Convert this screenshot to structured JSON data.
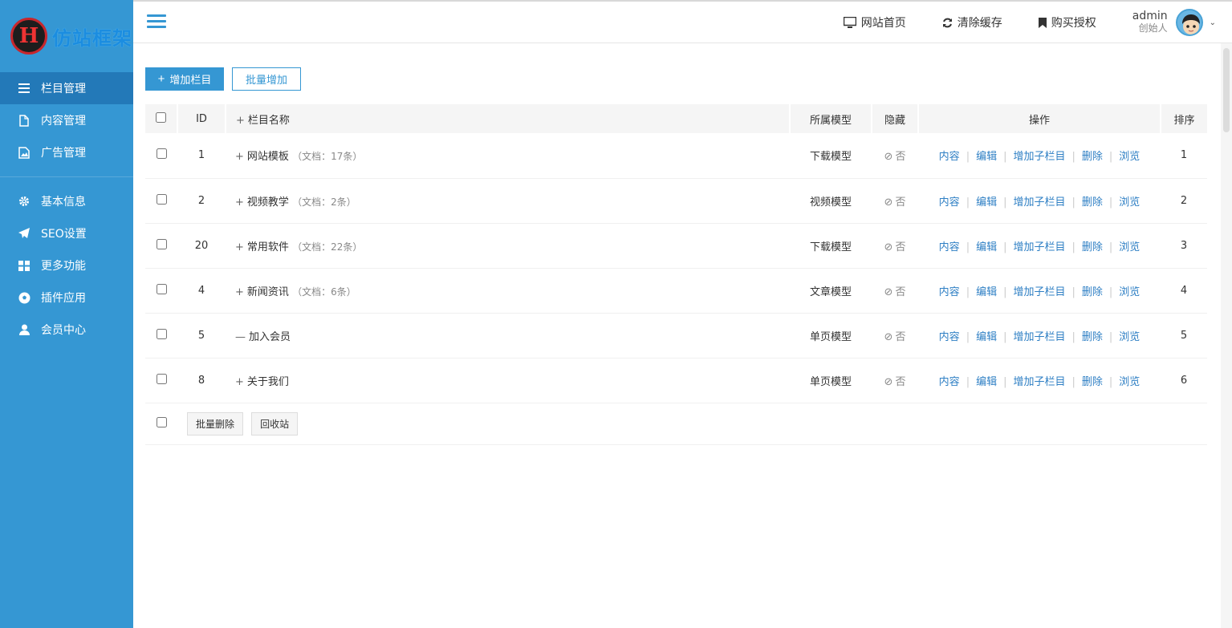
{
  "brand": {
    "logo_text": "仿站框架"
  },
  "sidebar": {
    "items": [
      {
        "label": "栏目管理",
        "icon": "list-icon",
        "active": true
      },
      {
        "label": "内容管理",
        "icon": "file-icon"
      },
      {
        "label": "广告管理",
        "icon": "image-icon"
      },
      {
        "label": "基本信息",
        "icon": "gear-icon"
      },
      {
        "label": "SEO设置",
        "icon": "send-icon"
      },
      {
        "label": "更多功能",
        "icon": "grid-icon"
      },
      {
        "label": "插件应用",
        "icon": "soccer-icon"
      },
      {
        "label": "会员中心",
        "icon": "user-icon"
      }
    ]
  },
  "header": {
    "links": [
      {
        "label": "网站首页",
        "icon": "monitor-icon"
      },
      {
        "label": "清除缓存",
        "icon": "refresh-icon"
      },
      {
        "label": "购买授权",
        "icon": "bookmark-icon"
      }
    ],
    "user": {
      "name": "admin",
      "role": "创始人"
    }
  },
  "toolbar": {
    "add_label": "增加栏目",
    "batch_add_label": "批量增加"
  },
  "table": {
    "headers": {
      "id": "ID",
      "name": "栏目名称",
      "model": "所属模型",
      "hidden": "隐藏",
      "ops": "操作",
      "sort": "排序"
    },
    "ops": [
      "内容",
      "编辑",
      "增加子栏目",
      "删除",
      "浏览"
    ],
    "rows": [
      {
        "id": "1",
        "sign": "+",
        "name": "网站模板",
        "count": "（文档：17条）",
        "model": "下载模型",
        "hidden": "否",
        "sort": "1"
      },
      {
        "id": "2",
        "sign": "+",
        "name": "视频教学",
        "count": "（文档：2条）",
        "model": "视频模型",
        "hidden": "否",
        "sort": "2"
      },
      {
        "id": "20",
        "sign": "+",
        "name": "常用软件",
        "count": "（文档：22条）",
        "model": "下载模型",
        "hidden": "否",
        "sort": "3"
      },
      {
        "id": "4",
        "sign": "+",
        "name": "新闻资讯",
        "count": "（文档：6条）",
        "model": "文章模型",
        "hidden": "否",
        "sort": "4"
      },
      {
        "id": "5",
        "sign": "—",
        "name": "加入会员",
        "count": "",
        "model": "单页模型",
        "hidden": "否",
        "sort": "5"
      },
      {
        "id": "8",
        "sign": "+",
        "name": "关于我们",
        "count": "",
        "model": "单页模型",
        "hidden": "否",
        "sort": "6"
      }
    ]
  },
  "footer": {
    "batch_delete_label": "批量删除",
    "recycle_label": "回收站"
  },
  "colors": {
    "primary": "#3597d3",
    "sidebar_active": "#2379b8",
    "link": "#2e7fc4"
  }
}
